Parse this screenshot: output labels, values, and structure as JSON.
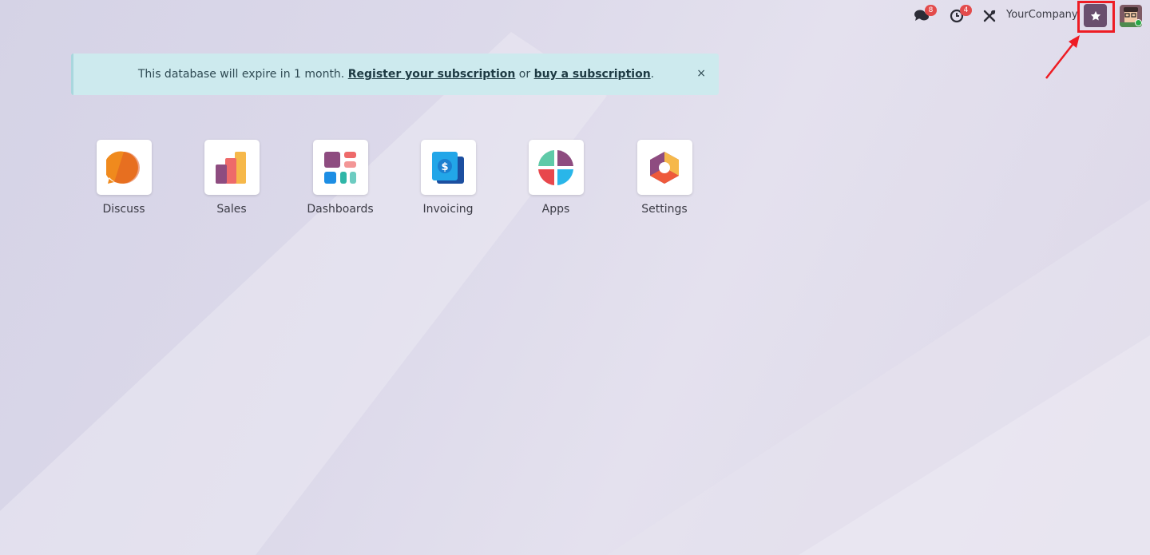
{
  "topbar": {
    "messages_badge": "8",
    "activity_badge": "4",
    "company": "YourCompany"
  },
  "alert": {
    "text_before": "This database will expire in 1 month. ",
    "register_link": "Register your subscription",
    "text_middle": " or ",
    "buy_link": "buy a subscription",
    "text_after": ".",
    "close": "×"
  },
  "apps": [
    {
      "label": "Discuss"
    },
    {
      "label": "Sales"
    },
    {
      "label": "Dashboards"
    },
    {
      "label": "Invoicing"
    },
    {
      "label": "Apps"
    },
    {
      "label": "Settings"
    }
  ],
  "colors": {
    "accent": "#6a4f6e",
    "highlight": "#ee1c24",
    "badge": "#e34b4b"
  }
}
